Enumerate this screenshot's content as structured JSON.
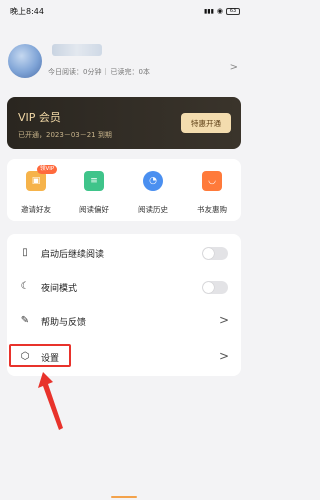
{
  "status_bar": {
    "time": "晚上8:44",
    "signal": "▮▮▮",
    "wifi": "◉",
    "battery": "63"
  },
  "profile": {
    "username": "用户",
    "today_reading": "今日阅读：0分钟",
    "finished": "已读完：0本"
  },
  "vip": {
    "title": "VIP 会员",
    "status": "已开通，2023－03－21 到期",
    "button": "特惠开通"
  },
  "shortcuts": [
    {
      "label": "邀请好友",
      "badge": "领VIP",
      "color": "#f6b34a"
    },
    {
      "label": "阅读偏好",
      "color": "#3fc48a"
    },
    {
      "label": "阅读历史",
      "color": "#4a8ff0"
    },
    {
      "label": "书友惠购",
      "color": "#ff7a3a"
    }
  ],
  "menu": [
    {
      "label": "启动后继续阅读",
      "icon": "book-icon",
      "control": "toggle",
      "on": false
    },
    {
      "label": "夜间模式",
      "icon": "moon-icon",
      "control": "toggle",
      "on": false
    },
    {
      "label": "帮助与反馈",
      "icon": "edit-icon",
      "control": "chevron"
    },
    {
      "label": "设置",
      "icon": "gear-icon",
      "control": "chevron"
    }
  ],
  "colors": {
    "annotation": "#e8322b",
    "vip_bg": "#2e2a24",
    "vip_gold": "#f3dcae"
  }
}
